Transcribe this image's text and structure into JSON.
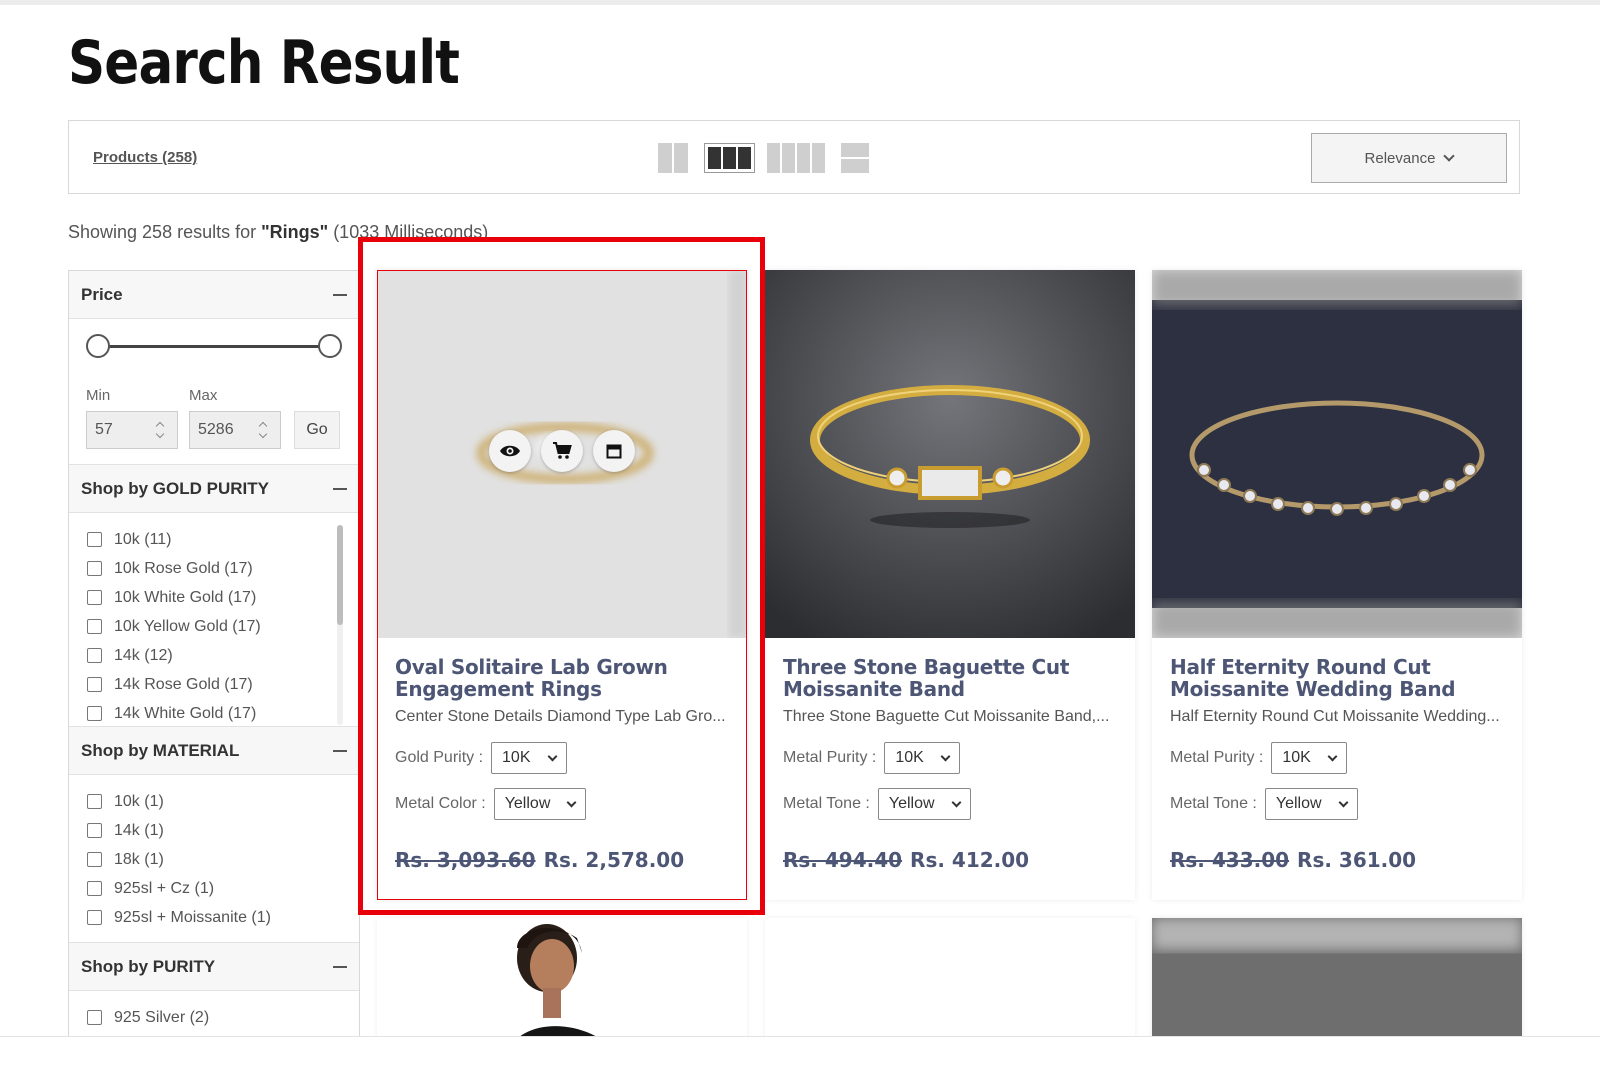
{
  "page_title": "Search Result",
  "toolbar": {
    "products_label": "Products (258)",
    "sort_label": "Relevance"
  },
  "showing": {
    "prefix": "Showing 258 results for ",
    "query": "\"Rings\"",
    "suffix": " (1033 Milliseconds)"
  },
  "filters": {
    "price": {
      "title": "Price",
      "min_label": "Min",
      "max_label": "Max",
      "min_value": "57",
      "max_value": "5286",
      "go_label": "Go"
    },
    "gold_purity": {
      "title": "Shop by GOLD PURITY",
      "options": [
        "10k (11)",
        "10k Rose Gold (17)",
        "10k White Gold (17)",
        "10k Yellow Gold (17)",
        "14k (12)",
        "14k Rose Gold (17)",
        "14k White Gold (17)"
      ]
    },
    "material": {
      "title": "Shop by MATERIAL",
      "options": [
        "10k (1)",
        "14k (1)",
        "18k (1)",
        "925sl + Cz (1)",
        "925sl + Moissanite (1)"
      ]
    },
    "purity": {
      "title": "Shop by PURITY",
      "options": [
        "925 Silver (2)"
      ]
    }
  },
  "products": [
    {
      "name": "Oval Solitaire Lab Grown Engagement Rings",
      "desc": "Center Stone Details Diamond Type Lab Gro...",
      "attr1_label": "Gold Purity :",
      "attr1_value": "10K",
      "attr2_label": "Metal Color :",
      "attr2_value": "Yellow",
      "price_old": "Rs. 3,093.60",
      "price_new": "Rs. 2,578.00"
    },
    {
      "name": "Three Stone Baguette Cut Moissanite Band",
      "desc": "Three Stone Baguette Cut Moissanite Band,...",
      "attr1_label": "Metal Purity :",
      "attr1_value": "10K",
      "attr2_label": "Metal Tone :",
      "attr2_value": "Yellow",
      "price_old": "Rs. 494.40",
      "price_new": "Rs. 412.00"
    },
    {
      "name": "Half Eternity Round Cut Moissanite Wedding Band",
      "desc": "Half Eternity Round Cut Moissanite Wedding...",
      "attr1_label": "Metal Purity :",
      "attr1_value": "10K",
      "attr2_label": "Metal Tone :",
      "attr2_value": "Yellow",
      "price_old": "Rs. 433.00",
      "price_new": "Rs. 361.00"
    }
  ],
  "hover_icons": [
    "eye-icon",
    "cart-icon",
    "calendar-icon"
  ],
  "colors": {
    "accent_title": "#4d5675",
    "highlight": "#e8000b"
  }
}
